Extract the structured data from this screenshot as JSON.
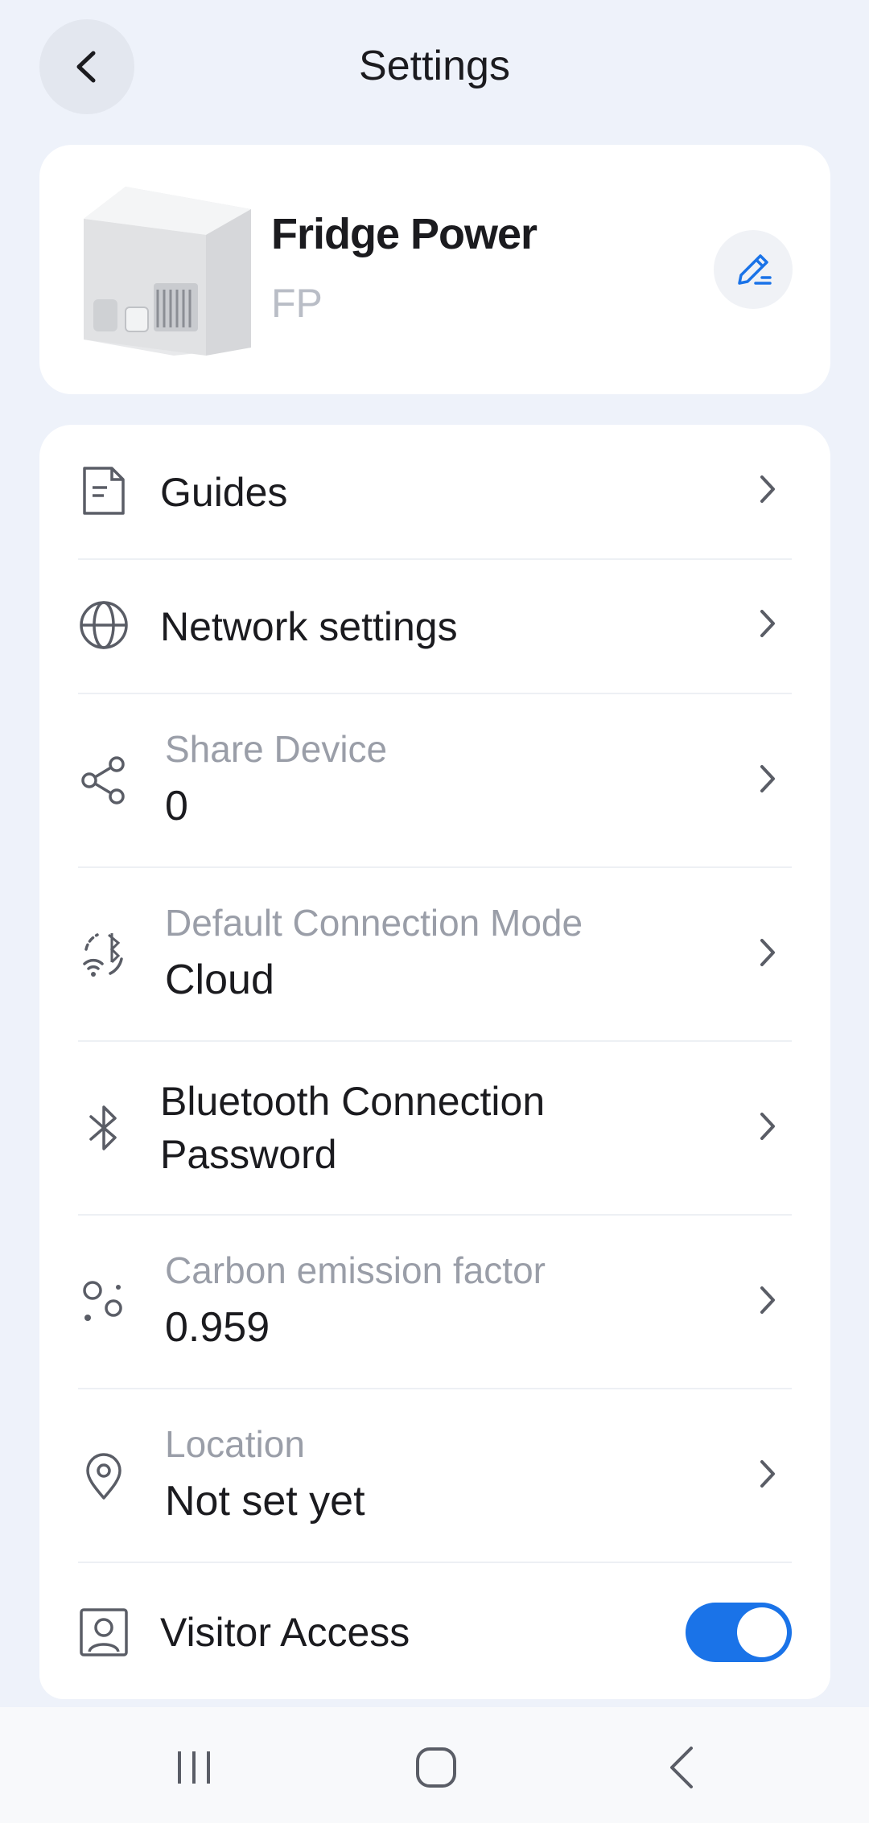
{
  "header": {
    "title": "Settings"
  },
  "device": {
    "name": "Fridge Power",
    "serial": "FP"
  },
  "items": [
    {
      "label": "Guides"
    },
    {
      "label": "Network settings"
    },
    {
      "sub": "Share Device",
      "value": "0"
    },
    {
      "sub": "Default Connection Mode",
      "value": "Cloud"
    },
    {
      "label_line1": "Bluetooth Connection",
      "label_line2": "Password"
    },
    {
      "sub": "Carbon emission factor",
      "value": "0.959"
    },
    {
      "sub": "Location",
      "value": "Not set yet"
    },
    {
      "label": "Visitor Access",
      "toggle_on": true
    }
  ],
  "colors": {
    "accent": "#1a73e8",
    "background": "#eef2fa",
    "card": "#ffffff",
    "muted_text": "#9a9ea8"
  },
  "icons": [
    "back-icon",
    "edit-icon",
    "document-icon",
    "globe-icon",
    "share-icon",
    "connection-mode-icon",
    "bluetooth-icon",
    "carbon-icon",
    "location-pin-icon",
    "visitor-icon",
    "chevron-right-icon",
    "recent-apps-icon",
    "home-icon",
    "nav-back-icon"
  ]
}
